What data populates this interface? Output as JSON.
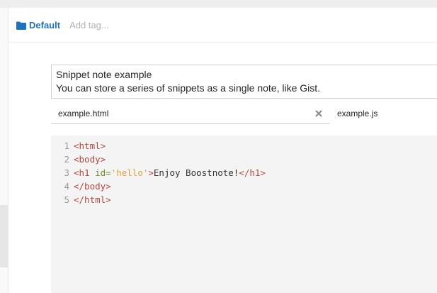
{
  "header": {
    "folder_label": "Default",
    "add_tag_placeholder": "Add tag..."
  },
  "description": {
    "line1": "Snippet note example",
    "line2": "You can store a series of snippets as a single note, like Gist."
  },
  "tabs": [
    {
      "label": "example.html",
      "active": true
    },
    {
      "label": "example.js",
      "active": false
    }
  ],
  "editor": {
    "line_numbers": [
      "1",
      "2",
      "3",
      "4",
      "5"
    ],
    "line1": "<html>",
    "line2": "<body>",
    "line3": {
      "open_tag": "<h1",
      "attr": " id=",
      "value": "'hello'",
      "close_bracket": ">",
      "text": "Enjoy Boostnote!",
      "end_tag": "</h1>"
    },
    "line4": "</body>",
    "line5": "</html>"
  },
  "colors": {
    "folder": "#1e73be",
    "tag": "#b04a3e",
    "attribute": "#6d8c2a",
    "string": "#d9a43b",
    "editor_background": "#f4f4f4"
  },
  "icons": {
    "folder": "folder-icon",
    "close": "close-icon"
  }
}
